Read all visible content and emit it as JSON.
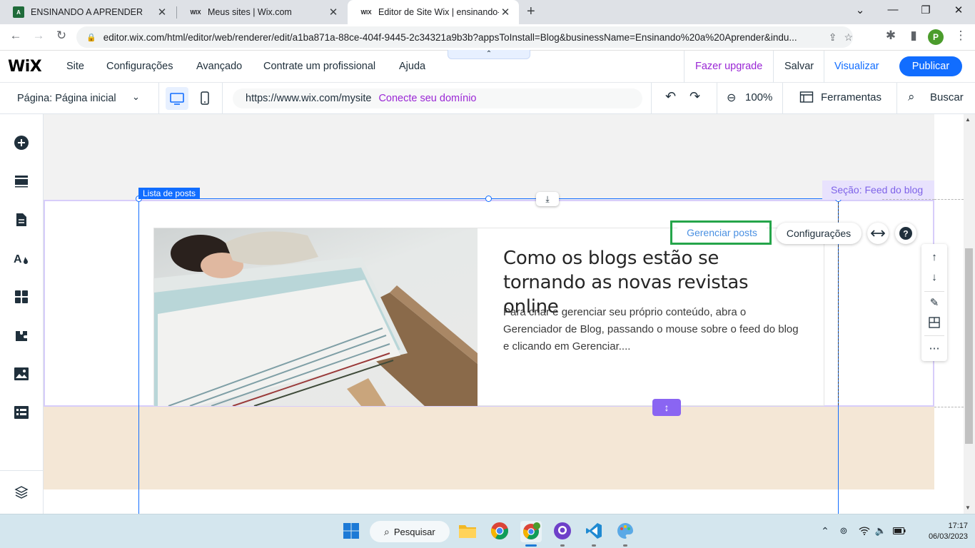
{
  "browser": {
    "tabs": [
      {
        "title": "ENSINANDO A APRENDER",
        "favicon": "aa-favicon"
      },
      {
        "title": "Meus sites | Wix.com",
        "favicon": "wix-favicon"
      },
      {
        "title": "Editor de Site Wix | ensinando-a-",
        "favicon": "wix-favicon"
      }
    ],
    "url": "editor.wix.com/html/editor/web/renderer/edit/a1ba871a-88ce-404f-9445-2c34321a9b3b?appsToInstall=Blog&businessName=Ensinando%20a%20Aprender&indu...",
    "profile_initial": "P"
  },
  "wix": {
    "logo": "WiX",
    "menu": [
      "Site",
      "Configurações",
      "Avançado",
      "Contrate um profissional",
      "Ajuda"
    ],
    "upgrade": "Fazer upgrade",
    "save": "Salvar",
    "preview": "Visualizar",
    "publish": "Publicar",
    "page_selector": "Página: Página inicial",
    "site_url": "https://www.wix.com/mysite",
    "connect_domain": "Conecte seu domínio",
    "zoom": "100%",
    "tools": "Ferramentas",
    "search": "Buscar",
    "colors": {
      "accent": "#116dff",
      "purple": "#9a27d5",
      "section": "#8a65f2",
      "highlight": "#25a54a"
    }
  },
  "canvas": {
    "element_label": "Lista de posts",
    "section_label": "Seção: Feed do blog",
    "manage_posts": "Gerenciar posts",
    "settings": "Configurações",
    "post": {
      "title": "Como os blogs estão se tornando as novas revistas online",
      "excerpt": "Para criar e gerenciar seu próprio conteúdo, abra o Gerenciador de Blog, passando o mouse sobre o feed do blog e clicando em Gerenciar...."
    }
  },
  "taskbar": {
    "search": "Pesquisar",
    "time": "17:17",
    "date": "06/03/2023"
  }
}
